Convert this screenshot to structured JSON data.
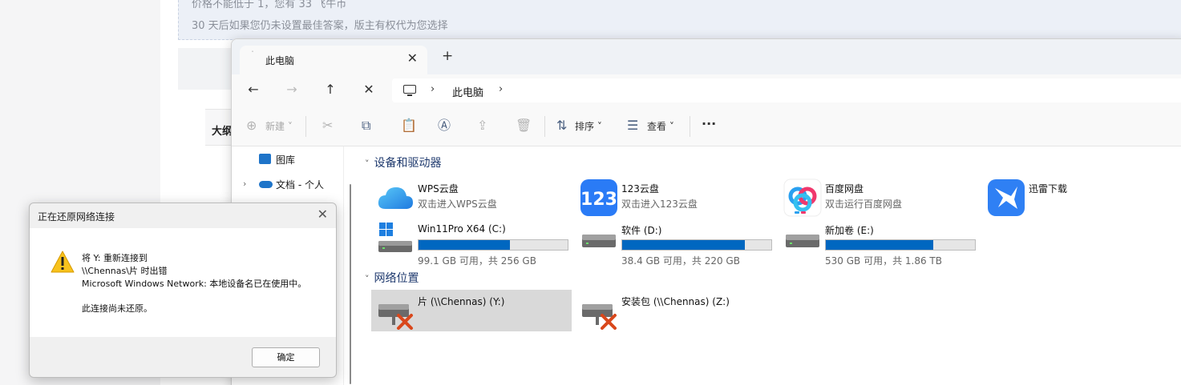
{
  "webpage": {
    "banner_line1": "价格不能低于 1，您有 33  飞牛币",
    "banner_line2": "30 天后如果您仍未设置最佳答案，版主有权代为您选择",
    "box_label": "大纲"
  },
  "explorer": {
    "tab": {
      "label": "此电脑",
      "close": "✕"
    },
    "new_tab": "+",
    "nav": {
      "back": "←",
      "forward": "→",
      "up": "↑",
      "refresh": "✕"
    },
    "address": {
      "location": "此电脑"
    },
    "toolbar": {
      "new_label": "新建",
      "sort_label": "排序",
      "view_label": "查看",
      "more": "···"
    },
    "nav_pane": {
      "items": [
        {
          "label": "图库"
        },
        {
          "label": "文档 - 个人"
        }
      ]
    },
    "groups": {
      "devices": "设备和驱动器",
      "network": "网络位置"
    },
    "apps": [
      {
        "name": "WPS云盘",
        "sub": "双击进入WPS云盘",
        "icon": "wps-cloud-icon"
      },
      {
        "name": "123云盘",
        "sub": "双击进入123云盘",
        "icon": "123-cloud-icon"
      },
      {
        "name": "百度网盘",
        "sub": "双击运行百度网盘",
        "icon": "baidu-netdisk-icon"
      },
      {
        "name": "迅雷下载",
        "sub": "",
        "icon": "thunder-download-icon"
      }
    ],
    "drives": [
      {
        "name": "Win11Pro X64 (C:)",
        "capacity": "99.1 GB 可用，共 256 GB",
        "used_fraction": 0.613,
        "icon": "windows-drive-icon"
      },
      {
        "name": "软件 (D:)",
        "capacity": "38.4 GB 可用，共 220 GB",
        "used_fraction": 0.825,
        "icon": "drive-icon"
      },
      {
        "name": "新加卷 (E:)",
        "capacity": "530 GB 可用，共 1.86 TB",
        "used_fraction": 0.722,
        "icon": "drive-icon"
      }
    ],
    "network_drives": [
      {
        "name": "片 (\\\\Chennas) (Y:)",
        "selected": true,
        "icon": "disconnected-network-drive-icon"
      },
      {
        "name": "安装包 (\\\\Chennas) (Z:)",
        "selected": false,
        "icon": "disconnected-network-drive-icon"
      }
    ],
    "colors": {
      "bar_fill": "#0067c0",
      "group_header": "#1f3a6e",
      "selected": "#d9d9d9"
    }
  },
  "dialog": {
    "title": "正在还原网络连接",
    "close": "✕",
    "line1": "将 Y: 重新连接到",
    "line2": "\\\\Chennas\\片 时出错",
    "line3": "Microsoft Windows Network: 本地设备名已在使用中。",
    "line4": "此连接尚未还原。",
    "ok_label": "确定",
    "icon": "warning-icon"
  }
}
